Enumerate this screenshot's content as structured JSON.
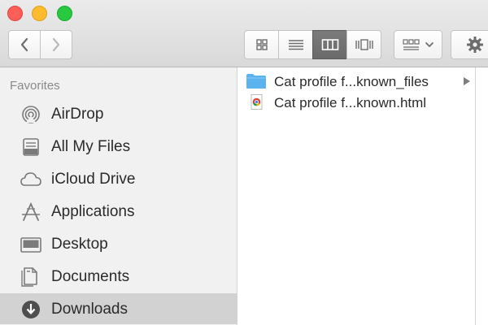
{
  "toolbar": {
    "traffic_lights": [
      "close",
      "minimize",
      "maximize"
    ],
    "nav": {
      "back_icon": "chevron-left-icon",
      "forward_icon": "chevron-right-icon"
    },
    "view_modes": [
      "icon-view",
      "list-view",
      "column-view",
      "cover-flow-view"
    ],
    "active_view": "column-view"
  },
  "sidebar": {
    "heading": "Favorites",
    "items": [
      {
        "label": "AirDrop",
        "icon": "airdrop-icon"
      },
      {
        "label": "All My Files",
        "icon": "all-files-icon"
      },
      {
        "label": "iCloud Drive",
        "icon": "cloud-icon"
      },
      {
        "label": "Applications",
        "icon": "applications-icon"
      },
      {
        "label": "Desktop",
        "icon": "desktop-icon"
      },
      {
        "label": "Documents",
        "icon": "documents-icon"
      },
      {
        "label": "Downloads",
        "icon": "downloads-icon",
        "selected": true
      }
    ]
  },
  "files": [
    {
      "name": "Cat profile f...known_files",
      "type": "folder",
      "icon": "folder-icon"
    },
    {
      "name": "Cat profile f...known.html",
      "type": "html",
      "icon": "chrome-html-icon"
    }
  ],
  "colors": {
    "folder": "#5ab3ef",
    "selected_row": "#d2d2d2",
    "sidebar_bg": "#f1f1f1"
  }
}
